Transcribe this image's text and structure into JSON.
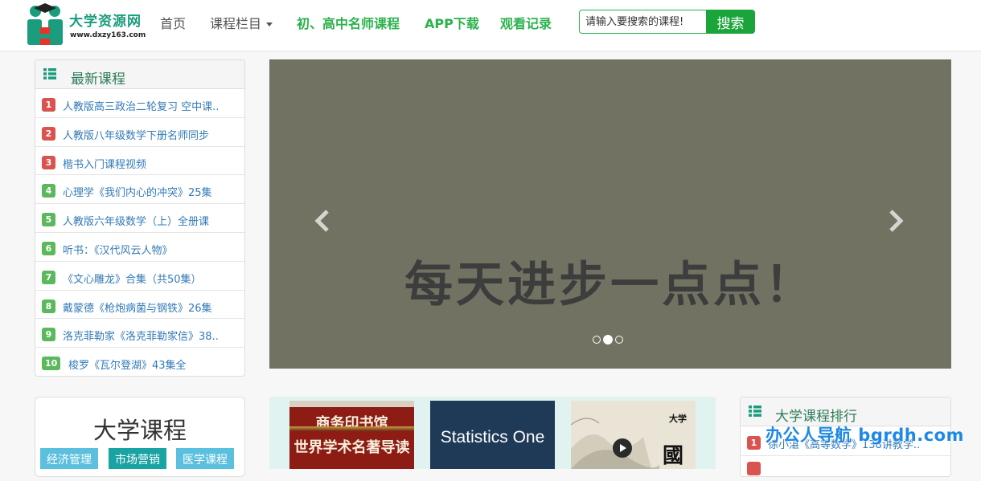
{
  "header": {
    "logo": {
      "title": "大学资源网",
      "url": "www.dxzy163.com"
    },
    "nav": [
      {
        "label": "首页"
      },
      {
        "label": "课程栏目"
      },
      {
        "label": "初、高中名师课程"
      },
      {
        "label": "APP下载"
      },
      {
        "label": "观看记录"
      }
    ],
    "search": {
      "placeholder": "请输入要搜索的课程!",
      "button": "搜索"
    }
  },
  "latest": {
    "title": "最新课程",
    "items": [
      {
        "rank": "1",
        "text": "人教版高三政治二轮复习 空中课.."
      },
      {
        "rank": "2",
        "text": "人教版八年级数学下册名师同步"
      },
      {
        "rank": "3",
        "text": "楷书入门课程视频"
      },
      {
        "rank": "4",
        "text": "心理学《我们内心的冲突》25集"
      },
      {
        "rank": "5",
        "text": "人教版六年级数学（上）全册课"
      },
      {
        "rank": "6",
        "text": "听书：《汉代风云人物》"
      },
      {
        "rank": "7",
        "text": "《文心雕龙》合集（共50集）"
      },
      {
        "rank": "8",
        "text": "戴蒙德《枪炮病菌与钢铁》26集"
      },
      {
        "rank": "9",
        "text": "洛克菲勒家《洛克菲勒家信》38.."
      },
      {
        "rank": "10",
        "text": "梭罗《瓦尔登湖》43集全"
      }
    ]
  },
  "carousel": {
    "slide_text": "每天进步一点点！",
    "active_index": 2,
    "dot_count": 3
  },
  "university": {
    "title": "大学课程",
    "tags": [
      "经济管理",
      "市场营销",
      "医学课程"
    ]
  },
  "books": [
    {
      "line1": "商务印书馆",
      "line2": "世界学术名著导读"
    },
    {
      "title": "Statistics One"
    },
    {
      "char1": "大学",
      "char2": "國"
    }
  ],
  "ranking": {
    "title": "大学课程排行",
    "items": [
      {
        "rank": "1",
        "text": "徐小湛《高等数学》138讲教学.."
      }
    ]
  },
  "watermark": {
    "text": "办公人导航  bgrdh.com"
  },
  "colors": {
    "brand_green": "#2bb24c",
    "rank_red": "#d9534f",
    "rank_green": "#5cb85c",
    "link_blue": "#337ab7",
    "tag_blue": "#5bc0de"
  }
}
